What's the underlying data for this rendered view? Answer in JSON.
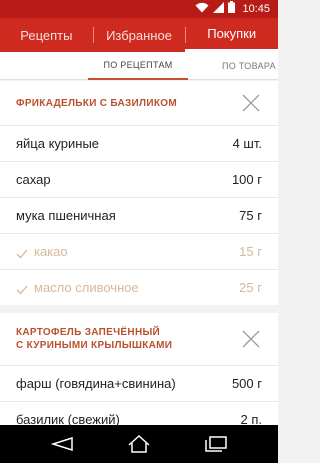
{
  "status": {
    "time": "10:45"
  },
  "tabs": [
    {
      "label": "Рецепты"
    },
    {
      "label": "Избранное"
    },
    {
      "label": "Покупки"
    }
  ],
  "subtabs": [
    {
      "label": "ПО РЕЦЕПТАМ"
    },
    {
      "label": "ПО ТОВАРА"
    }
  ],
  "recipes": [
    {
      "title": "ФРИКАДЕЛЬКИ С БАЗИЛИКОМ",
      "items": [
        {
          "name": "яйца куриные",
          "amount": "4 шт."
        },
        {
          "name": "сахар",
          "amount": "100 г"
        },
        {
          "name": "мука пшеничная",
          "amount": "75 г"
        },
        {
          "name": "какао",
          "amount": "15 г",
          "checked": true
        },
        {
          "name": "масло сливочное",
          "amount": "25 г",
          "checked": true
        }
      ]
    },
    {
      "title_line1": "КАРТОФЕЛЬ ЗАПЕЧЁННЫЙ",
      "title_line2": "С КУРИНЫМИ КРЫЛЫШКАМИ",
      "items": [
        {
          "name": "фарш (говядина+свинина)",
          "amount": "500 г"
        },
        {
          "name": "базилик (свежий)",
          "amount": "2 п."
        }
      ]
    }
  ],
  "colors": {
    "status_bar": "#b71c17",
    "tab_bar": "#cf2a1f",
    "accent": "#b8522e",
    "checked_text": "#d6b89a"
  },
  "icons": {
    "status": [
      "wifi-icon",
      "signal-icon",
      "battery-icon"
    ],
    "nav": [
      "back-icon",
      "home-icon",
      "recents-icon"
    ],
    "recipe": "close-icon",
    "item": "check-icon"
  }
}
